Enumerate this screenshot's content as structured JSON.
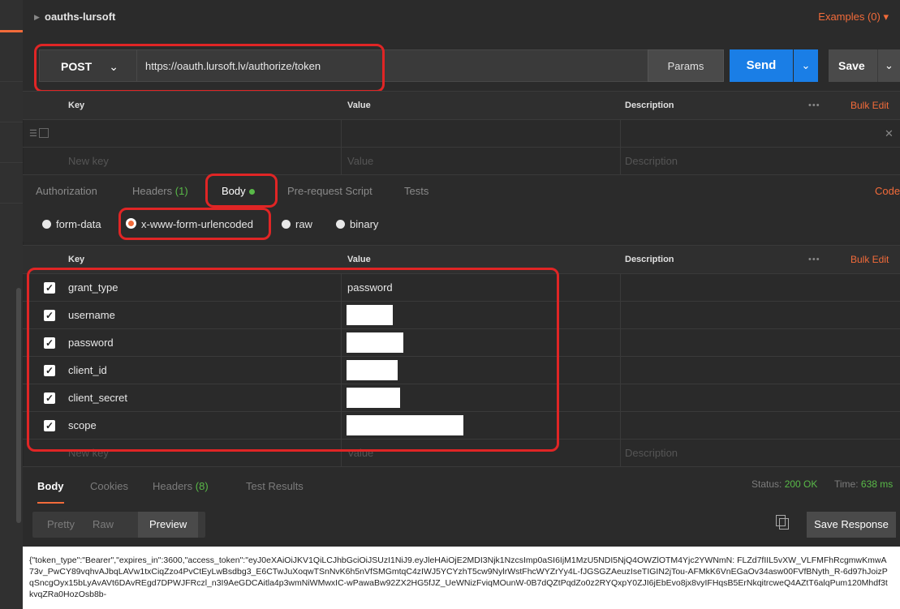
{
  "collection": {
    "name": "oauths-lursoft",
    "examples": "Examples (0) ▾"
  },
  "request": {
    "method": "POST",
    "url": "https://oauth.lursoft.lv/authorize/token",
    "params_label": "Params",
    "send_label": "Send",
    "save_label": "Save"
  },
  "params_table": {
    "headers": {
      "key": "Key",
      "value": "Value",
      "description": "Description",
      "dots": "•••",
      "bulk_edit": "Bulk Edit"
    },
    "placeholders": {
      "key": "New key",
      "value": "Value",
      "description": "Description"
    }
  },
  "tabs": {
    "authorization": "Authorization",
    "headers": "Headers",
    "headers_count": "(1)",
    "body": "Body",
    "prerequest": "Pre-request Script",
    "tests": "Tests",
    "code": "Code"
  },
  "body_modes": {
    "form_data": "form-data",
    "urlencoded": "x-www-form-urlencoded",
    "raw": "raw",
    "binary": "binary"
  },
  "body_table": {
    "headers": {
      "key": "Key",
      "value": "Value",
      "description": "Description",
      "dots": "•••",
      "bulk_edit": "Bulk Edit"
    },
    "rows": [
      {
        "key": "grant_type",
        "value": "password"
      },
      {
        "key": "username",
        "value": ""
      },
      {
        "key": "password",
        "value": ""
      },
      {
        "key": "client_id",
        "value": ""
      },
      {
        "key": "client_secret",
        "value": ""
      },
      {
        "key": "scope",
        "value": ""
      }
    ],
    "placeholders": {
      "key": "New key",
      "value": "Value",
      "description": "Description"
    }
  },
  "response": {
    "tabs": {
      "body": "Body",
      "cookies": "Cookies",
      "headers": "Headers",
      "headers_count": "(8)",
      "test_results": "Test Results"
    },
    "status_label": "Status:",
    "status_value": "200 OK",
    "time_label": "Time:",
    "time_value": "638 ms",
    "views": {
      "pretty": "Pretty",
      "raw": "Raw",
      "preview": "Preview"
    },
    "save_response": "Save Response",
    "body_text": "{\"token_type\":\"Bearer\",\"expires_in\":3600,\"access_token\":\"eyJ0eXAiOiJKV1QiLCJhbGciOiJSUzI1NiJ9.eyJleHAiOjE2MDI3Njk1NzcsImp0aSI6IjM1MzU5NDI5NjQ4OWZlOTM4Yjc2YWNmN: FLZd7fIIL5vXW_VLFMFhRcgmwKmwA73v_PwCY89vqhvAJbqLAVw1txCiqZzo4PvCtEyLwBsdbg3_E6CTwJuXoqwTSnNvK6h5nVfSMGmtqC4zIWJ5YCYzhT5cw9NylrWstFhcWYZrYy4L-fJGSGZAeuzIseTIGIN2jTou-AFMkK6VnEGaOv34asw00FVfBNyth_R-6d97hJoizPqSncgOyx15bLyAvAVt6DAvREgd7DPWJFRczl_n3I9AeGDCAitla4p3wmNiWMwxIC-wPawaBw92ZX2HG5fJZ_UeWNizFviqMOunW-0B7dQZtPqdZo0z2RYQxpY0ZJI6jEbEvo8jx8vyIFHqsB5ErNkqitrcweQ4AZtT6alqPum120Mhdf3tkvqZRa0HozOsb8b-"
  }
}
